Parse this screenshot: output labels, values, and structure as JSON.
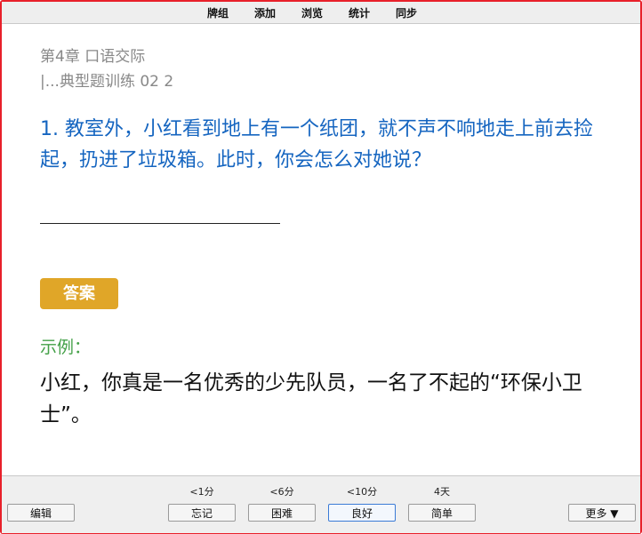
{
  "menu": {
    "items": [
      "牌组",
      "添加",
      "浏览",
      "统计",
      "同步"
    ]
  },
  "card": {
    "deck": "第4章 口语交际",
    "subdeck": "|...典型题训练 02 2",
    "question": "1. 教室外，小红看到地上有一个纸团，就不声不响地走上前去捡起，扔进了垃圾箱。此时，你会怎么对她说？",
    "answer_badge": "答案",
    "example_label": "示例：",
    "answer": "小红，你真是一名优秀的少先队员，一名了不起的“环保小卫士”。"
  },
  "colors": {
    "question": "#1565c0",
    "badge": "#e0a628",
    "example": "#43a047",
    "frame": "#e8202a"
  },
  "bottom": {
    "edit_label": "编辑",
    "more_label": "更多 ▼",
    "answers": [
      {
        "interval": "<1分",
        "label": "忘记"
      },
      {
        "interval": "<6分",
        "label": "困难"
      },
      {
        "interval": "<10分",
        "label": "良好"
      },
      {
        "interval": "4天",
        "label": "简单"
      }
    ]
  }
}
